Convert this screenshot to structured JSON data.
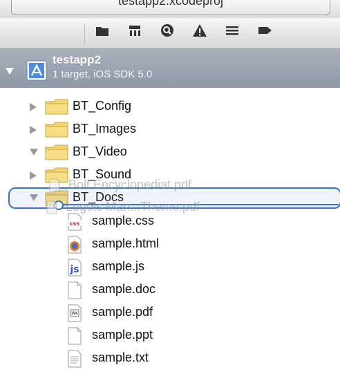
{
  "window": {
    "title": "testapp2.xcodeproj"
  },
  "navigator_tabs": [
    {
      "icon": "folder-icon"
    },
    {
      "icon": "hierarchy-icon"
    },
    {
      "icon": "search-icon"
    },
    {
      "icon": "warning-icon"
    },
    {
      "icon": "list-icon"
    },
    {
      "icon": "breakpoint-icon"
    }
  ],
  "project": {
    "name": "testapp2",
    "subtitle": "1 target, iOS SDK 5.0"
  },
  "folders": [
    {
      "label": "BT_Config",
      "expanded": false
    },
    {
      "label": "BT_Images",
      "expanded": false
    },
    {
      "label": "BT_Video",
      "expanded": true
    },
    {
      "label": "BT_Sound",
      "expanded": false
    },
    {
      "label": "BT_Docs",
      "expanded": true
    }
  ],
  "files": [
    {
      "label": "sample.css",
      "icon": "css-file-icon"
    },
    {
      "label": "sample.html",
      "icon": "html-file-icon"
    },
    {
      "label": "sample.js",
      "icon": "js-file-icon"
    },
    {
      "label": "sample.doc",
      "icon": "doc-file-icon"
    },
    {
      "label": "sample.pdf",
      "icon": "pdf-file-icon"
    },
    {
      "label": "sample.ppt",
      "icon": "ppt-file-icon"
    },
    {
      "label": "sample.txt",
      "icon": "txt-file-icon"
    }
  ],
  "drag_ghost": {
    "items": [
      "Bolt Encyclopediat.pdf",
      "Lugois Man...Theme.pdf"
    ]
  },
  "colors": {
    "selection_bar": "#979fad",
    "drop_indicator": "#3b73c7",
    "folder_yellow": "#f4d774"
  }
}
